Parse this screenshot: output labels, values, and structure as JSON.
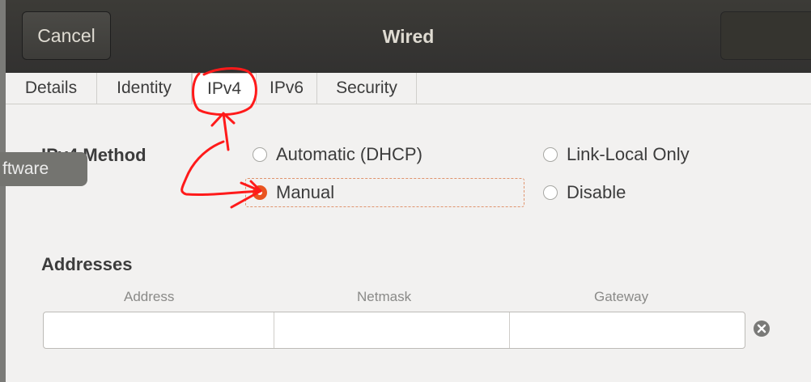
{
  "header": {
    "title": "Wired",
    "cancel_label": "Cancel",
    "apply_label": ""
  },
  "tabs": [
    {
      "label": "Details",
      "active": false
    },
    {
      "label": "Identity",
      "active": false
    },
    {
      "label": "IPv4",
      "active": true
    },
    {
      "label": "IPv6",
      "active": false
    },
    {
      "label": "Security",
      "active": false
    }
  ],
  "ipv4_method": {
    "label": "IPv4 Method",
    "options": [
      {
        "label": "Automatic (DHCP)",
        "checked": false
      },
      {
        "label": "Link-Local Only",
        "checked": false
      },
      {
        "label": "Manual",
        "checked": true
      },
      {
        "label": "Disable",
        "checked": false
      }
    ]
  },
  "tooltip": {
    "text": "ftware"
  },
  "addresses": {
    "label": "Addresses",
    "columns": [
      "Address",
      "Netmask",
      "Gateway"
    ],
    "row": {
      "address": "",
      "netmask": "",
      "gateway": ""
    }
  },
  "colors": {
    "accent": "#e95420",
    "headerbar": "#3c3b37",
    "annotation": "#ff0000"
  },
  "icons": {
    "clear": "clear-icon"
  }
}
